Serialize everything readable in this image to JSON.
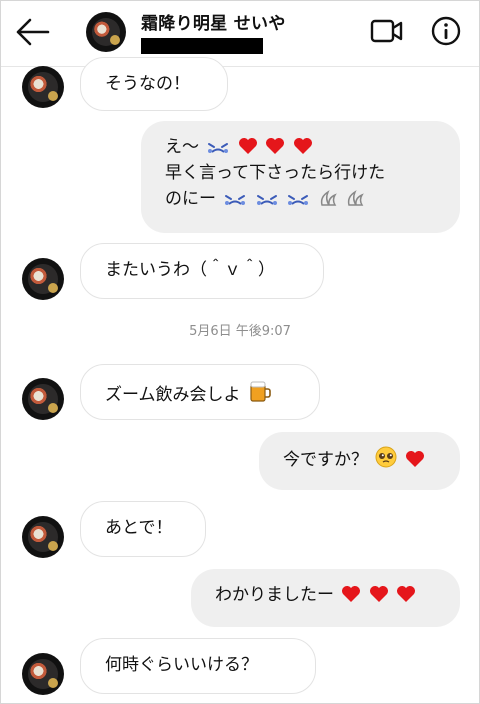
{
  "header": {
    "name": "霜降り明星 せいや"
  },
  "timestamp": "5月6日 午後9:07",
  "messages": [
    {
      "direction": "incoming",
      "text": "そうなの！"
    },
    {
      "direction": "outgoing",
      "lines": [
        "え〜",
        "早く言って下さったら行けた",
        "のにー"
      ]
    },
    {
      "direction": "incoming",
      "text": "またいうわ（＾ｖ＾）"
    },
    {
      "direction": "incoming",
      "text": "ズーム飲み会しよ"
    },
    {
      "direction": "outgoing",
      "text": "今ですか？"
    },
    {
      "direction": "incoming",
      "text": "あとで！"
    },
    {
      "direction": "outgoing",
      "text": "わかりましたー"
    },
    {
      "direction": "incoming",
      "text": "何時ぐらいいける？"
    }
  ],
  "icons": [
    "back-arrow-icon",
    "video-call-icon",
    "info-icon",
    "crying-face-icon",
    "red-heart-icon",
    "beer-mug-icon",
    "pleading-face-icon",
    "sweat-drops-icon"
  ],
  "colors": {
    "heart": "#e5161b",
    "crying_face": "#3b5bb8",
    "outgoing_bubble": "#efefef",
    "incoming_border": "#e3e3e3"
  }
}
